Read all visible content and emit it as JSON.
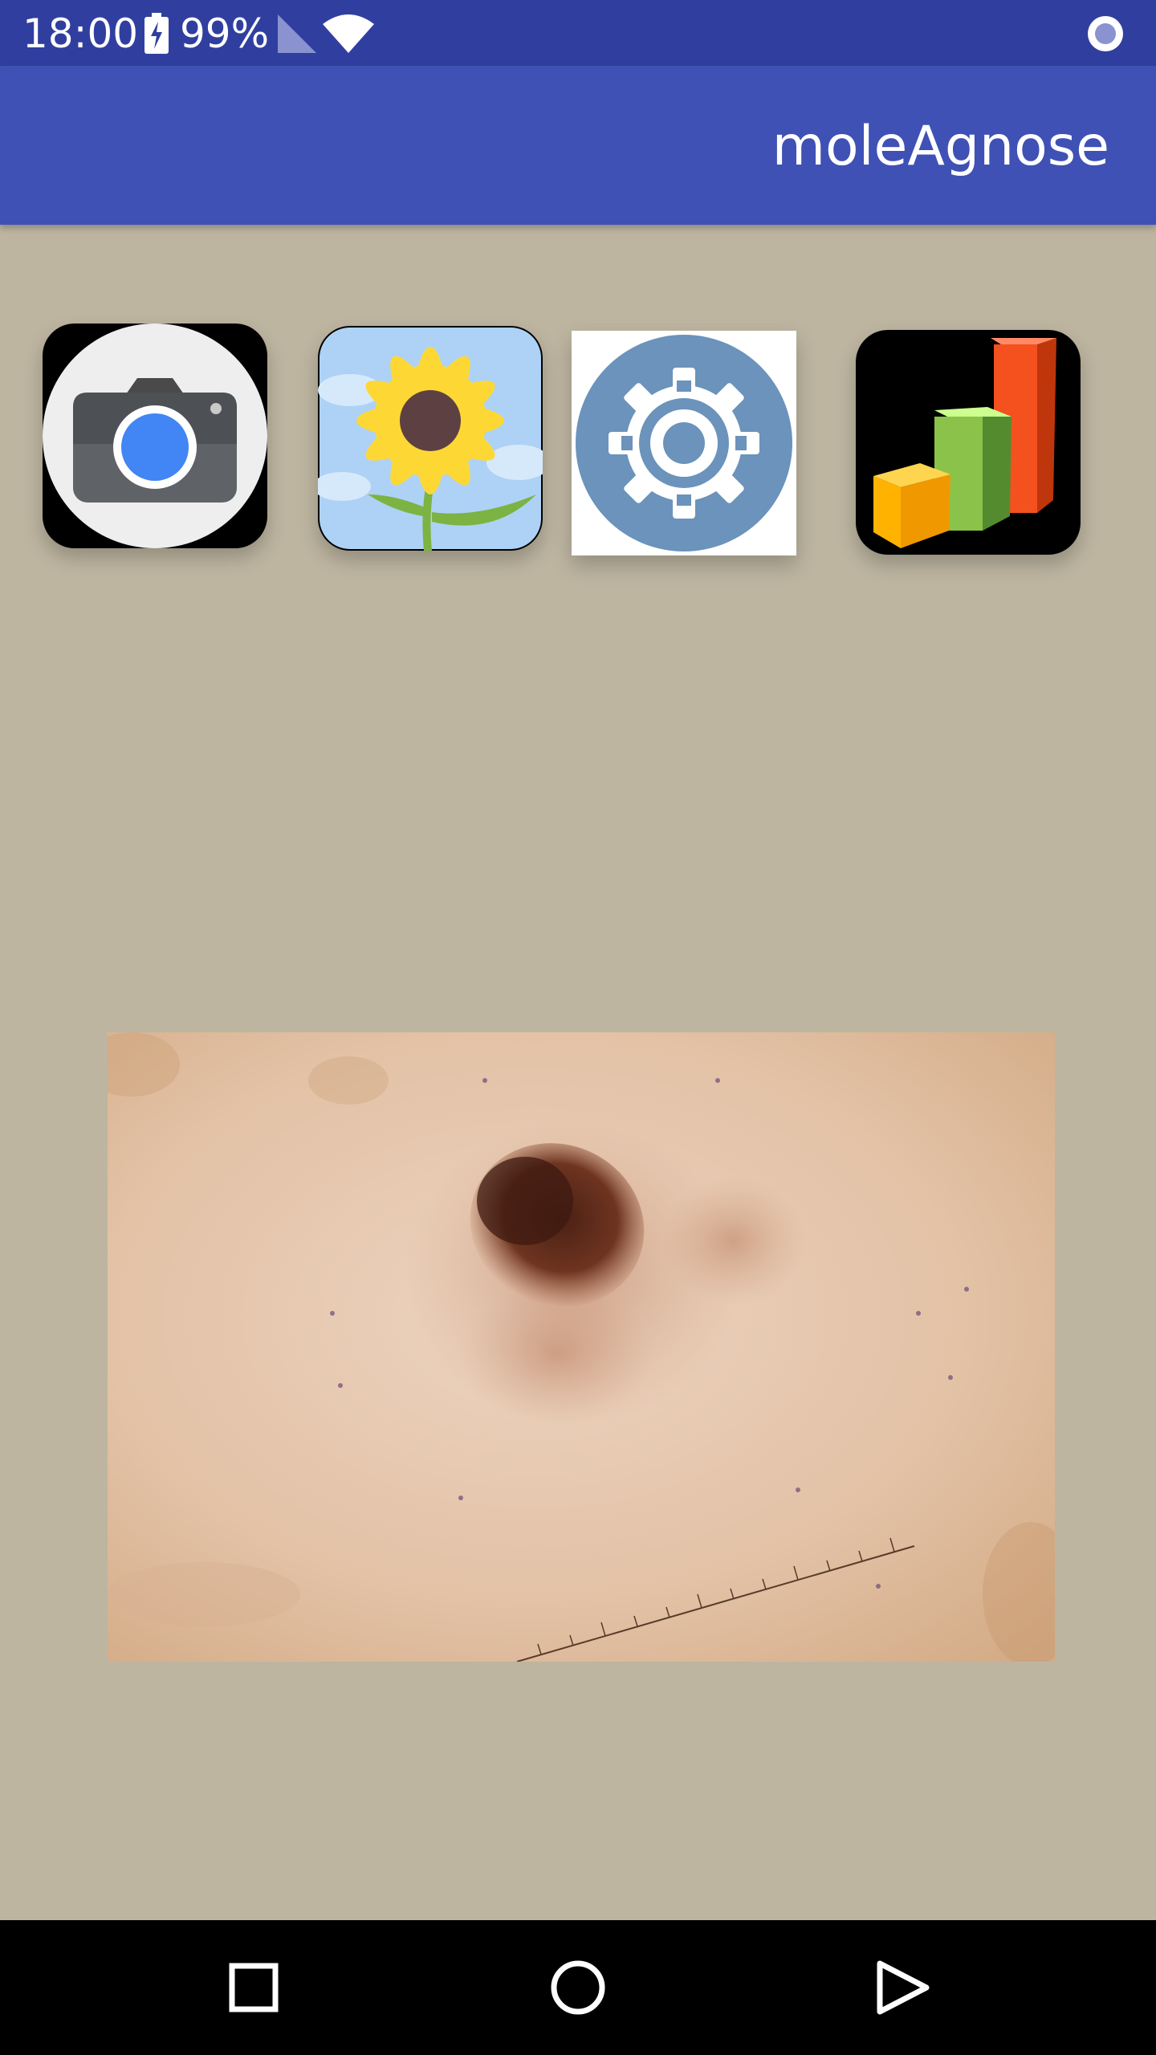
{
  "status_bar": {
    "time": "18:00",
    "battery_percent": "99%",
    "icons": [
      "battery-charging-icon",
      "cell-signal-icon",
      "wifi-icon",
      "record-indicator-icon"
    ]
  },
  "app_bar": {
    "title": "moleAgnose"
  },
  "toolbar": {
    "tiles": [
      {
        "icon": "camera-icon"
      },
      {
        "icon": "gallery-sunflower-icon"
      },
      {
        "icon": "settings-gear-icon"
      },
      {
        "icon": "statistics-bar-chart-icon"
      }
    ]
  },
  "main": {
    "image": "dermoscopy-mole-image"
  },
  "navigation": {
    "buttons": [
      "recents-square-icon",
      "home-circle-icon",
      "back-triangle-icon"
    ]
  },
  "colors": {
    "status_bar": "#303f9f",
    "app_bar": "#3f51b5",
    "background": "#bdb5a0",
    "nav_bar": "#000000"
  }
}
